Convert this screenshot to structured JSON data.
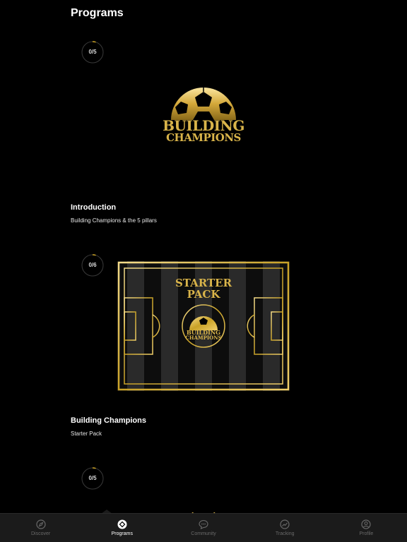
{
  "header": {
    "title": "Programs"
  },
  "programs": [
    {
      "progress": "0/5",
      "progress_fraction": 0.05,
      "logo_line1": "BUILDING",
      "logo_line2": "CHAMPIONS",
      "title": "Introduction",
      "subtitle": "Building Champions & the 5 pillars"
    },
    {
      "progress": "0/6",
      "progress_fraction": 0.05,
      "image_heading_line1": "STARTER",
      "image_heading_line2": "PACK",
      "logo_line1": "BUILDING",
      "logo_line2": "CHAMPIONS",
      "title": "Building Champions",
      "subtitle": "Starter Pack"
    },
    {
      "progress": "0/5",
      "progress_fraction": 0.05
    }
  ],
  "colors": {
    "gold": "#c9a227",
    "gold_light": "#f2d47a",
    "background": "#000000",
    "nav_bg": "#1b1b1b"
  },
  "nav": {
    "items": [
      {
        "label": "Discover",
        "icon": "compass-icon",
        "active": false
      },
      {
        "label": "Programs",
        "icon": "programs-icon",
        "active": true
      },
      {
        "label": "Community",
        "icon": "chat-bubble-icon",
        "active": false
      },
      {
        "label": "Tracking",
        "icon": "trend-chart-icon",
        "active": false
      },
      {
        "label": "Profile",
        "icon": "user-icon",
        "active": false
      }
    ]
  }
}
